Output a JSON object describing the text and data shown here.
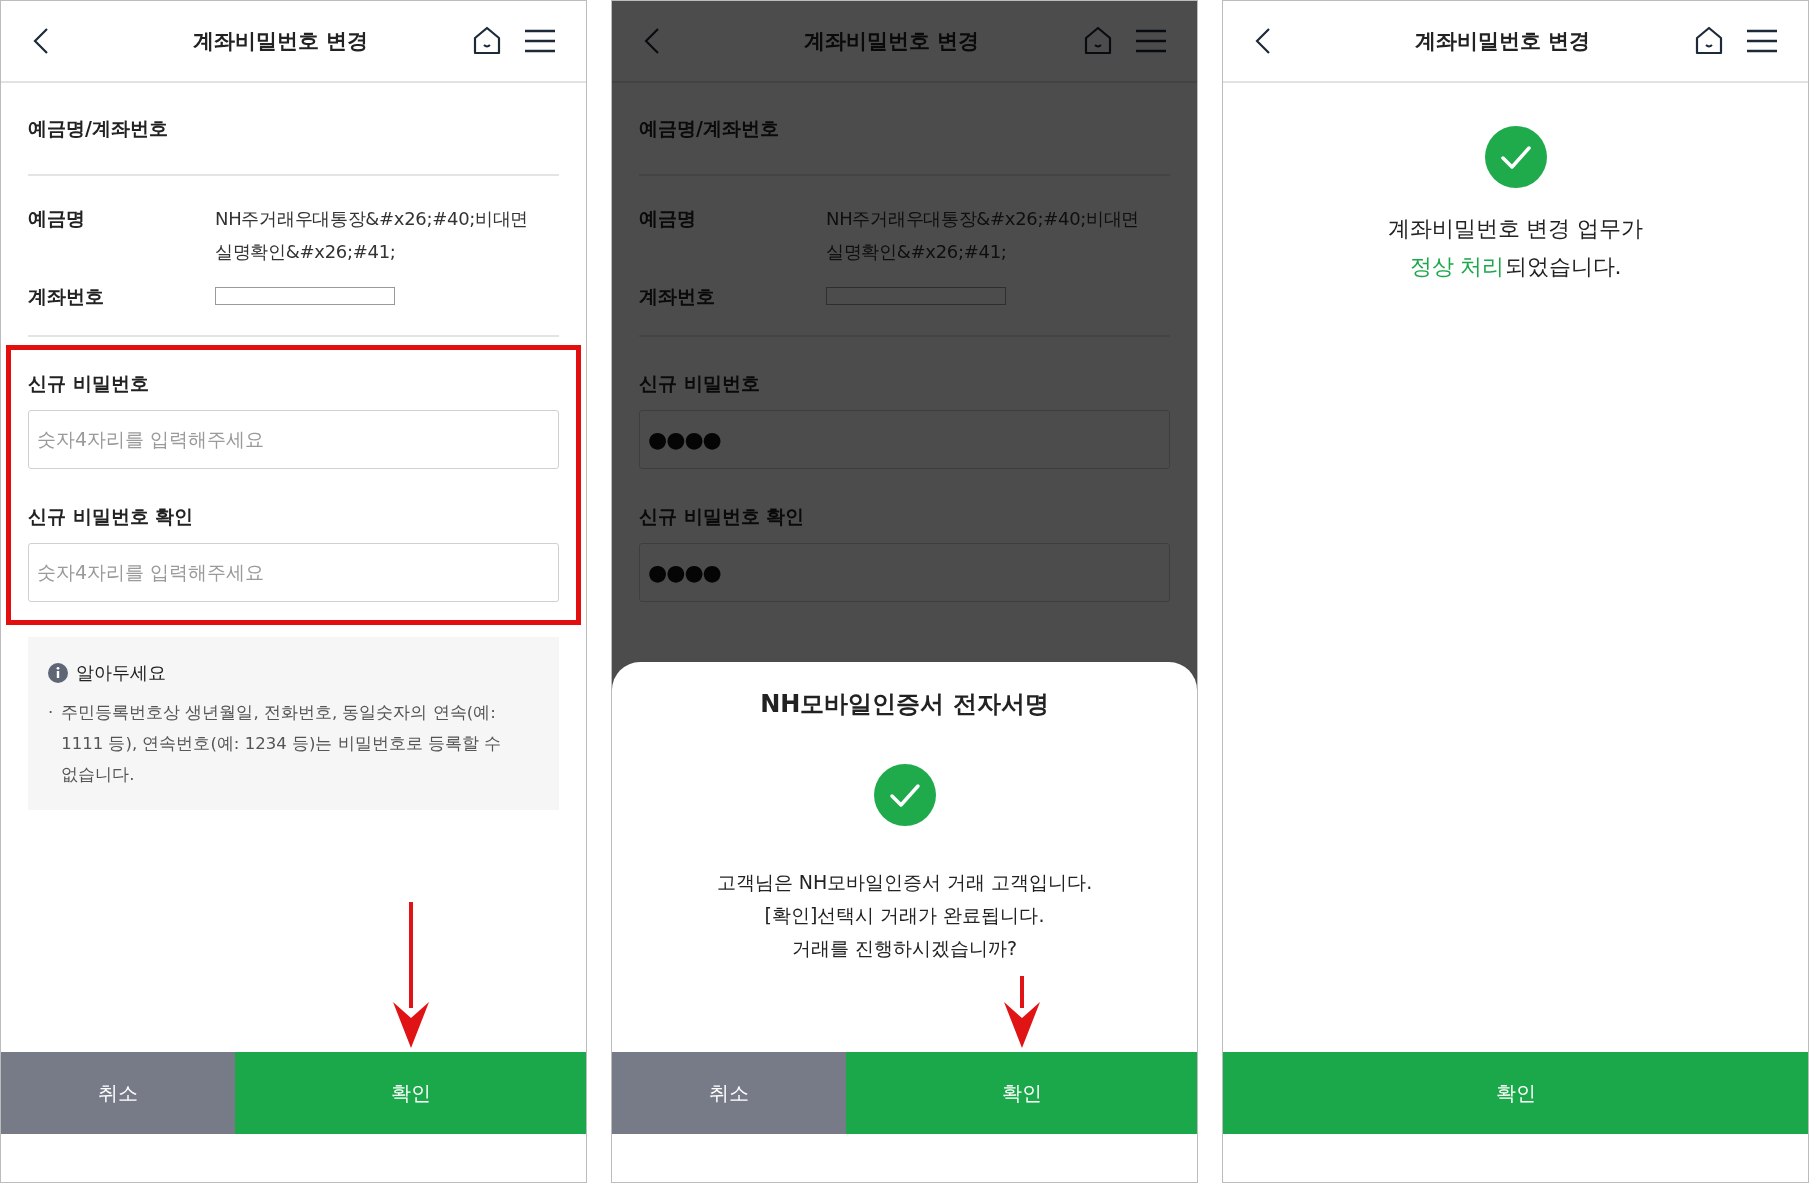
{
  "panels": [
    {
      "kind": "form",
      "header": {
        "title": "계좌비밀번호 변경"
      },
      "section_title": "예금명/계좌번호",
      "details": [
        {
          "kind": "text",
          "label": "예금명",
          "value": "NH주거래우대통장&#x26;#40;비대면실명확인&#x26;#41;"
        },
        {
          "kind": "blank",
          "label": "계좌번호"
        }
      ],
      "highlighted": true,
      "fields": [
        {
          "label": "신규 비밀번호",
          "placeholder": "숫자4자리를 입력해주세요"
        },
        {
          "label": "신규 비밀번호 확인",
          "placeholder": "숫자4자리를 입력해주세요"
        }
      ],
      "notice": {
        "title": "알아두세요",
        "bullet": "·",
        "text": "주민등록번호상 생년월일, 전화번호, 동일숫자의 연속(예: 1111 등), 연속번호(예: 1234 등)는 비밀번호로 등록할 수 없습니다."
      },
      "buttons": [
        {
          "kind": "cancel",
          "label": "취소"
        },
        {
          "kind": "confirm",
          "label": "확인",
          "arrow": true
        }
      ]
    },
    {
      "kind": "form",
      "dimmed": true,
      "header": {
        "title": "계좌비밀번호 변경"
      },
      "section_title": "예금명/계좌번호",
      "details": [
        {
          "kind": "text",
          "label": "예금명",
          "value": "NH주거래우대통장&#x26;#40;비대면실명확인&#x26;#41;"
        },
        {
          "kind": "blank",
          "label": "계좌번호"
        }
      ],
      "fields": [
        {
          "label": "신규 비밀번호",
          "value": "●●●●"
        },
        {
          "label": "신규 비밀번호 확인",
          "value": "●●●●"
        }
      ],
      "sheet": {
        "title": "NH모바일인증서 전자서명",
        "message": [
          "고객님은 NH모바일인증서 거래 고객입니다.",
          "[확인]선택시 거래가 완료됩니다.",
          "거래를 진행하시겠습니까?"
        ],
        "buttons": [
          {
            "kind": "cancel",
            "label": "취소"
          },
          {
            "kind": "confirm",
            "label": "확인",
            "arrow": true
          }
        ]
      }
    },
    {
      "kind": "result",
      "header": {
        "title": "계좌비밀번호 변경"
      },
      "message": {
        "line": "계좌비밀번호 변경 업무가",
        "highlight": "정상 처리",
        "rest": "되었습니다."
      },
      "buttons": [
        {
          "kind": "confirm",
          "label": "확인"
        }
      ]
    }
  ]
}
